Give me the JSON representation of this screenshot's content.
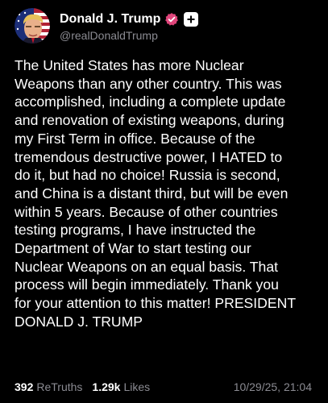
{
  "author": {
    "display_name": "Donald J. Trump",
    "handle": "@realDonaldTrump",
    "verified_badge_color": "#e0457b",
    "verified_icon": "check-badge-icon",
    "follow_icon": "plus-icon"
  },
  "post": {
    "text": "The United States has more Nuclear\nWeapons than any other country. This was\naccomplished, including a complete update\nand renovation of existing weapons, during\nmy First Term in office. Because of the\ntremendous destructive power, I HATED to\ndo it, but had no choice! Russia is second,\nand China is a distant third, but will be even\nwithin 5 years. Because of other countries\ntesting programs, I have instructed the\nDepartment of War to start testing our\nNuclear Weapons on an equal basis. That\nprocess will begin immediately. Thank you\nfor your attention to this matter! PRESIDENT\nDONALD J. TRUMP"
  },
  "stats": {
    "retruths_count": "392",
    "retruths_label": "ReTruths",
    "likes_count": "1.29k",
    "likes_label": "Likes",
    "timestamp": "10/29/25, 21:04"
  },
  "colors": {
    "background": "#000000",
    "text": "#ffffff",
    "muted": "#8b8b92"
  }
}
